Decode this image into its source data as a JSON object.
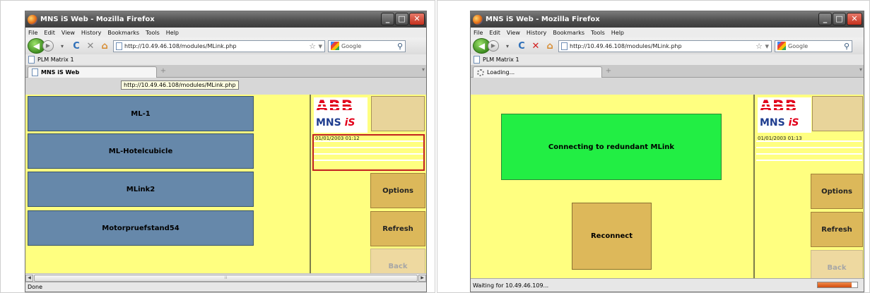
{
  "left": {
    "window_title": "MNS iS Web - Mozilla Firefox",
    "menu": [
      "File",
      "Edit",
      "View",
      "History",
      "Bookmarks",
      "Tools",
      "Help"
    ],
    "url": "http://10.49.46.108/modules/MLink.php",
    "search_placeholder": "Google",
    "bookmark": "PLM Matrix 1",
    "tab_title": "MNS iS Web",
    "tooltip": "http://10.49.46.108/modules/MLink.php",
    "mlinks": [
      "ML-1",
      "ML-Hotelcubicle",
      "MLink2",
      "Motorpruefstand54"
    ],
    "datetime": "01/01/2003 01:12",
    "options_label": "Options",
    "refresh_label": "Refresh",
    "back_label": "Back",
    "status": "Done"
  },
  "right": {
    "window_title": "MNS iS Web - Mozilla Firefox",
    "menu": [
      "File",
      "Edit",
      "View",
      "History",
      "Bookmarks",
      "Tools",
      "Help"
    ],
    "url": "http://10.49.46.108/modules/MLink.php",
    "search_placeholder": "Google",
    "bookmark": "PLM Matrix 1",
    "tab_title": "Loading...",
    "connecting_message": "Connecting to redundant MLink",
    "reconnect_label": "Reconnect",
    "datetime": "01/01/2003 01:13",
    "options_label": "Options",
    "refresh_label": "Refresh",
    "back_label": "Back",
    "status": "Waiting for 10.49.46.109...",
    "progress": 0.85
  },
  "logo": {
    "abb": "ABB",
    "mns": "MNS",
    "is": "iS"
  },
  "colors": {
    "page_background": "#ffff80",
    "mlink_button": "#6688aa",
    "side_button": "#dcb85a",
    "connecting": "#22ee44",
    "abb_red": "#e2001a"
  },
  "icons": {
    "back": "back-arrow-icon",
    "forward": "forward-arrow-icon",
    "reload": "reload-icon",
    "stop": "stop-icon",
    "home": "home-icon",
    "star": "star-icon",
    "search": "magnifier-icon"
  }
}
